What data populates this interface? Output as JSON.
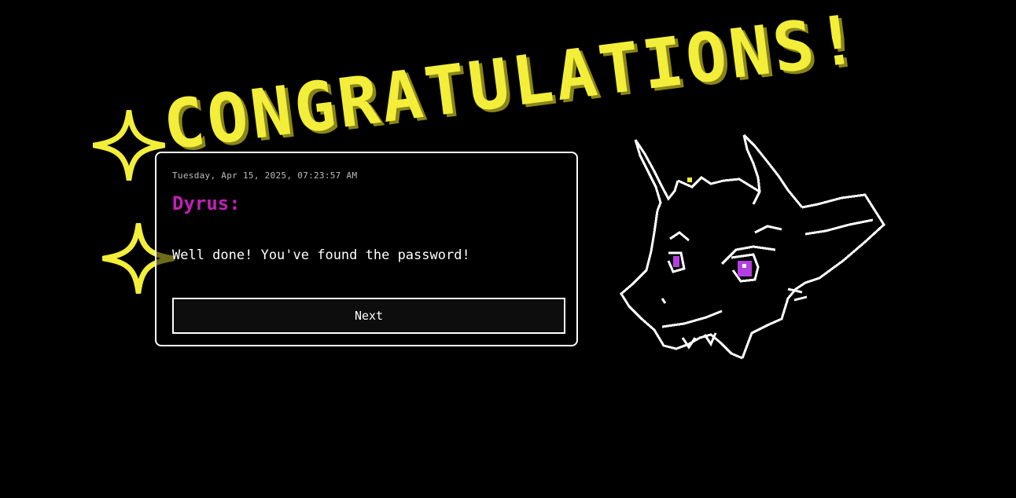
{
  "banner": {
    "text": "CONGRATULATIONS!"
  },
  "dialog": {
    "timestamp": "Tuesday, Apr 15, 2025, 07:23:57 AM",
    "speaker": "Dyrus:",
    "message": "Well done! You've found the password!",
    "next_label": "Next"
  },
  "colors": {
    "background": "#000000",
    "banner": "#f2ee3a",
    "speaker": "#c31fb6",
    "eye": "#b43fe0",
    "line_art": "#ffffff"
  },
  "icons": {
    "sparkle": "four-point-star-icon",
    "character": "dragon-head-illustration"
  }
}
